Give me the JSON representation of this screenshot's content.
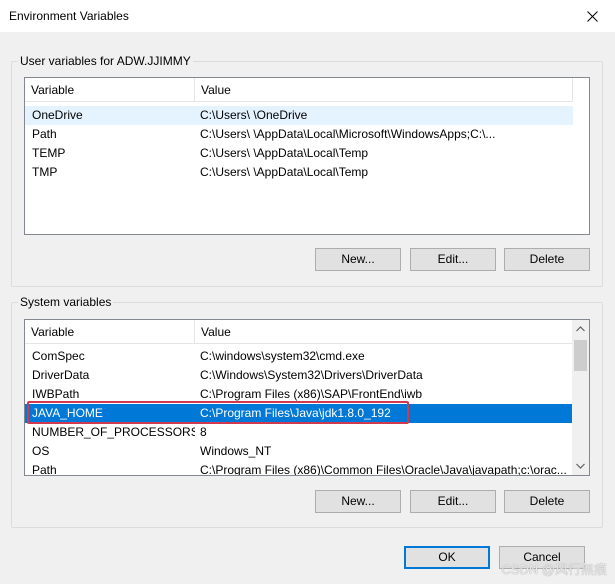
{
  "window": {
    "title": "Environment Variables"
  },
  "user_group": {
    "label": "User variables for ADW.JJIMMY",
    "columns": [
      "Variable",
      "Value"
    ],
    "rows": [
      {
        "variable": "OneDrive",
        "value": "C:\\Users\\              \\OneDrive"
      },
      {
        "variable": "Path",
        "value": "C:\\Users\\              \\AppData\\Local\\Microsoft\\WindowsApps;C:\\..."
      },
      {
        "variable": "TEMP",
        "value": "C:\\Users\\              \\AppData\\Local\\Temp"
      },
      {
        "variable": "TMP",
        "value": "C:\\Users\\              \\AppData\\Local\\Temp"
      }
    ],
    "buttons": {
      "new": "New...",
      "edit": "Edit...",
      "delete": "Delete"
    }
  },
  "system_group": {
    "label": "System variables",
    "columns": [
      "Variable",
      "Value"
    ],
    "rows": [
      {
        "variable": "ComSpec",
        "value": "C:\\windows\\system32\\cmd.exe"
      },
      {
        "variable": "DriverData",
        "value": "C:\\Windows\\System32\\Drivers\\DriverData"
      },
      {
        "variable": "IWBPath",
        "value": "C:\\Program Files (x86)\\SAP\\FrontEnd\\iwb"
      },
      {
        "variable": "JAVA_HOME",
        "value": "C:\\Program Files\\Java\\jdk1.8.0_192"
      },
      {
        "variable": "NUMBER_OF_PROCESSORS",
        "value": "8"
      },
      {
        "variable": "OS",
        "value": "Windows_NT"
      },
      {
        "variable": "Path",
        "value": "C:\\Program Files (x86)\\Common Files\\Oracle\\Java\\javapath;c:\\orac..."
      }
    ],
    "buttons": {
      "new": "New...",
      "edit": "Edit...",
      "delete": "Delete"
    }
  },
  "footer": {
    "ok": "OK",
    "cancel": "Cancel"
  },
  "watermark": "CSDN @风行無痕",
  "colors": {
    "selection": "#0078d7",
    "highlight_box": "#d03a4f",
    "default_button_border": "#0078d7"
  }
}
